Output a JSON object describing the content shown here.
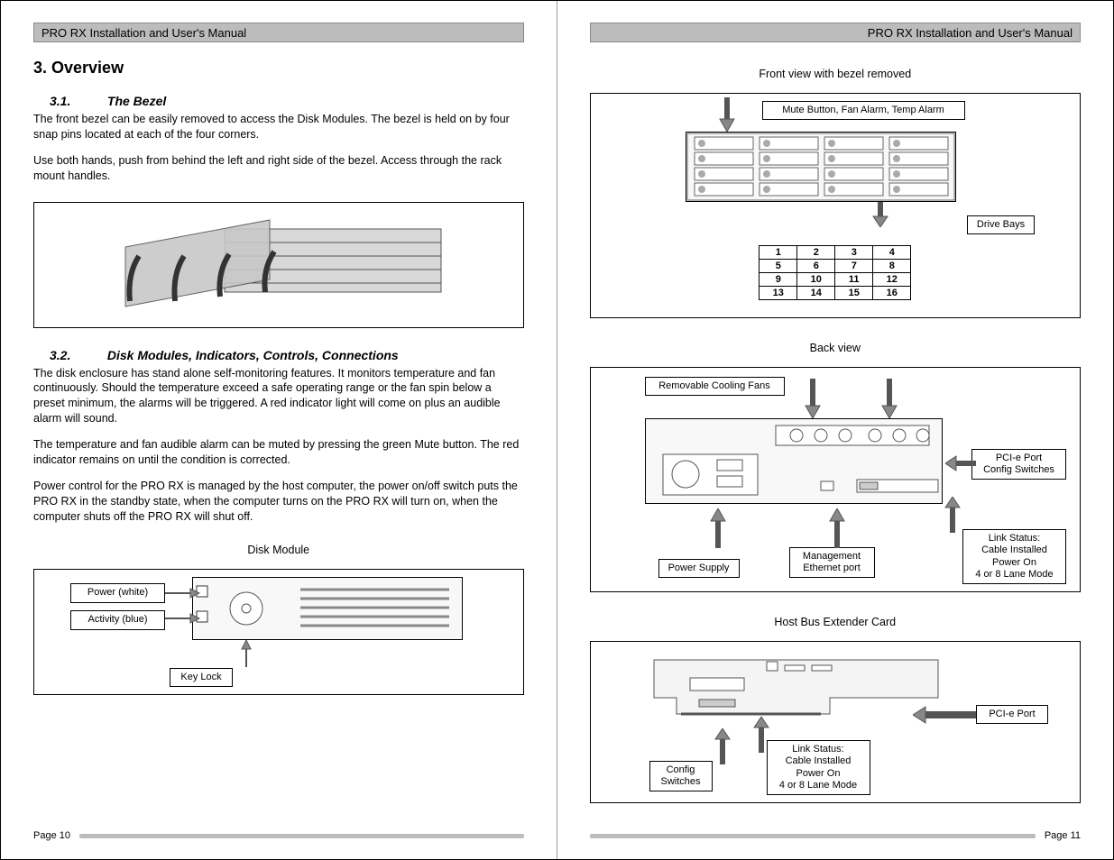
{
  "header": {
    "manual_title": "PRO RX Installation and User's Manual"
  },
  "left": {
    "section_title": "3. Overview",
    "sub1_num": "3.1.",
    "sub1_title": "The Bezel",
    "p1": "The front bezel can be easily removed to access the Disk Modules.  The bezel is held on by four snap pins located at each of the four corners.",
    "p2": "Use both hands, push from behind the left and right side of the bezel.  Access through the rack mount handles.",
    "sub2_num": "3.2.",
    "sub2_title": "Disk Modules, Indicators, Controls, Connections",
    "p3": "The disk enclosure has stand alone self-monitoring features.  It monitors temperature and fan continuously.  Should the temperature exceed a safe operating range or the fan spin below a preset minimum, the alarms will be triggered.  A red indicator light will come on plus an audible alarm will sound.",
    "p4": "The temperature and fan audible alarm can be muted by pressing the green Mute button.  The red indicator remains on until the condition is corrected.",
    "p5": "Power control for the PRO RX is managed by the host computer, the power on/off switch puts the PRO RX in the standby state, when the computer turns on the PRO RX will turn on, when the computer shuts off the PRO RX will shut off.",
    "disk_caption": "Disk Module",
    "lbl_power": "Power (white)",
    "lbl_activity": "Activity (blue)",
    "lbl_keylock": "Key Lock",
    "page_num": "Page 10"
  },
  "right": {
    "front_caption": "Front view with bezel removed",
    "lbl_mute": "Mute Button, Fan Alarm, Temp Alarm",
    "lbl_drivebays": "Drive Bays",
    "back_caption": "Back view",
    "lbl_fans": "Removable Cooling Fans",
    "lbl_pcie_switch": "PCI-e Port\nConfig Switches",
    "lbl_power_supply": "Power Supply",
    "lbl_mgmt": "Management\nEthernet port",
    "lbl_link": "Link Status:\nCable Installed\nPower On\n4 or 8 Lane Mode",
    "hbe_caption": "Host Bus Extender Card",
    "lbl_config_sw": "Config\nSwitches",
    "lbl_pcie_port": "PCI-e Port",
    "page_num": "Page 11"
  },
  "chart_data": {
    "type": "table",
    "title": "Drive Bays",
    "rows": [
      [
        "1",
        "2",
        "3",
        "4"
      ],
      [
        "5",
        "6",
        "7",
        "8"
      ],
      [
        "9",
        "10",
        "11",
        "12"
      ],
      [
        "13",
        "14",
        "15",
        "16"
      ]
    ]
  }
}
